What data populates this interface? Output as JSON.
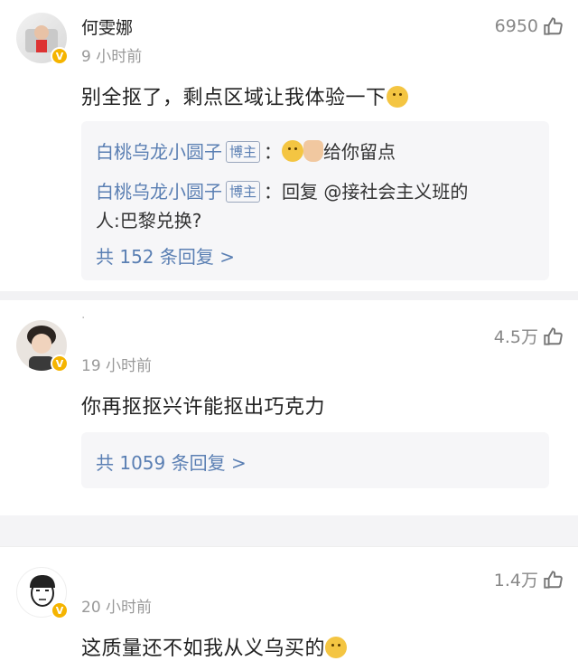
{
  "comments": [
    {
      "user": "何雯娜",
      "time": "9 小时前",
      "likes": "6950",
      "text": "别全抠了，剩点区域让我体验一下",
      "replies": [
        {
          "name": "白桃乌龙小圆子",
          "tag": "博主",
          "sep": "：",
          "text": "给你留点"
        },
        {
          "name": "白桃乌龙小圆子",
          "tag": "博主",
          "sep": "：",
          "text_line1": "回复 @接社会主义班的",
          "text_line2": "人:巴黎兑换?"
        }
      ],
      "reply_count": "共 152 条回复 >"
    },
    {
      "user": "·",
      "time": "19 小时前",
      "likes": "4.5万",
      "text": "你再抠抠兴许能抠出巧克力",
      "reply_count": "共 1059 条回复 >"
    },
    {
      "user": "",
      "time": "20 小时前",
      "likes": "1.4万",
      "text": "这质量还不如我从义乌买的"
    }
  ],
  "colors": {
    "link": "#5a7fb3",
    "badge": "#f5b400",
    "muted": "#999999"
  },
  "icons": {
    "like": "thumbs-up-icon",
    "verified": "v-badge-icon",
    "emoji": "doge-emoji"
  }
}
